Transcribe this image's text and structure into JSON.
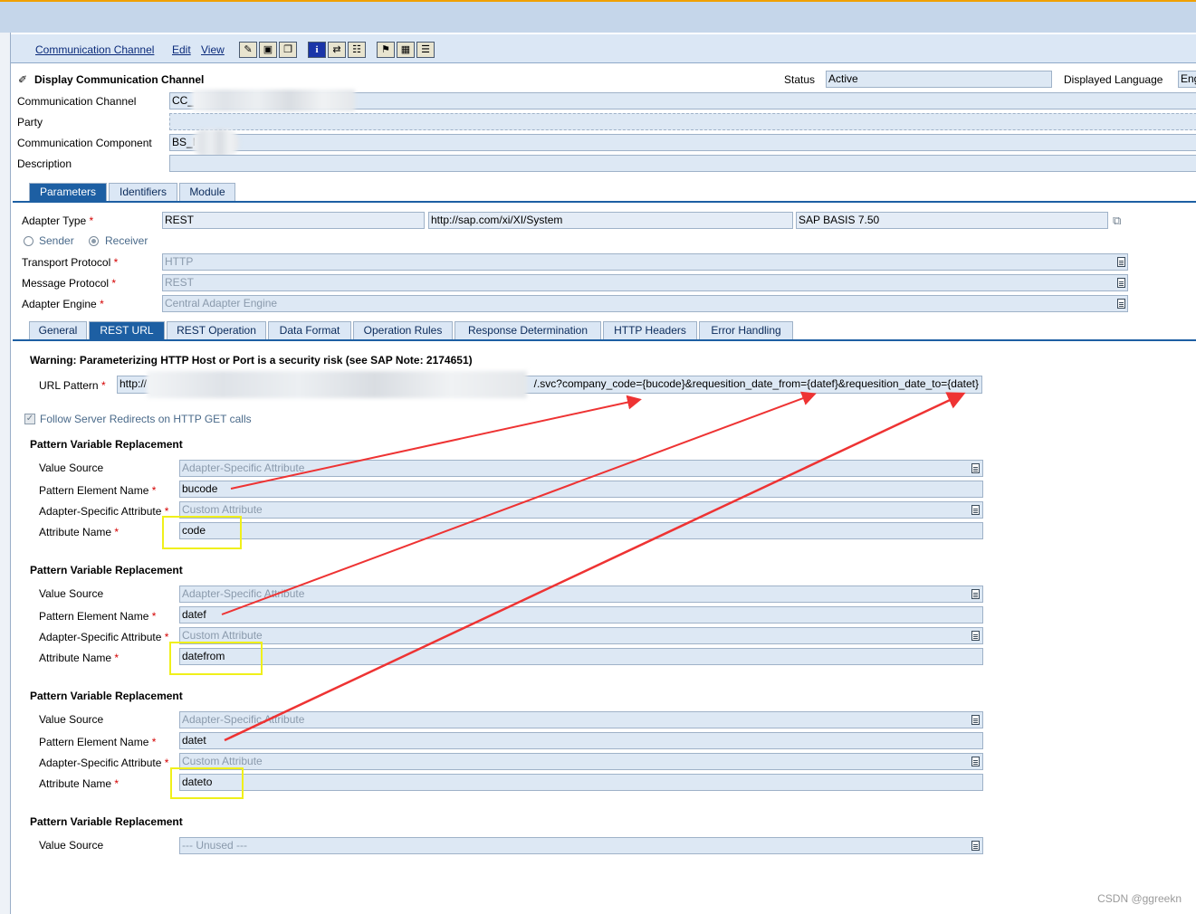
{
  "menu": {
    "items": [
      {
        "label": "Communication Channel"
      },
      {
        "label": "Edit"
      },
      {
        "label": "View"
      }
    ]
  },
  "header": {
    "title": "Display Communication Channel",
    "status_label": "Status",
    "status_value": "Active",
    "lang_label": "Displayed Language",
    "lang_value": "Eng"
  },
  "object": {
    "channel_label": "Communication Channel",
    "channel_value": "CC_",
    "party_label": "Party",
    "party_value": "",
    "component_label": "Communication Component",
    "component_value": "BS_I",
    "description_label": "Description",
    "description_value": ""
  },
  "main_tabs": [
    "Parameters",
    "Identifiers",
    "Module"
  ],
  "adapter": {
    "type_label": "Adapter Type",
    "type_value": "REST",
    "namespace": "http://sap.com/xi/XI/System",
    "version": "SAP BASIS 7.50",
    "sender_label": "Sender",
    "receiver_label": "Receiver",
    "transport_label": "Transport Protocol",
    "transport_value": "HTTP",
    "message_label": "Message Protocol",
    "message_value": "REST",
    "engine_label": "Adapter Engine",
    "engine_value": "Central Adapter Engine"
  },
  "sub_tabs": [
    "General",
    "REST URL",
    "REST Operation",
    "Data Format",
    "Operation Rules",
    "Response Determination",
    "HTTP Headers",
    "Error Handling"
  ],
  "rest_url": {
    "warning": "Warning: Parameterizing HTTP Host or Port is a security risk (see SAP Note: 2174651)",
    "url_label": "URL Pattern",
    "url_prefix": "http://",
    "url_suffix": "/.svc?company_code={bucode}&requesition_date_from={datef}&requesition_date_to={datet}",
    "follow_label": "Follow Server Redirects on HTTP GET calls"
  },
  "replacement_labels": {
    "section": "Pattern Variable Replacement",
    "value_source": "Value Source",
    "element_name": "Pattern Element Name",
    "specific_attr": "Adapter-Specific Attribute",
    "attr_name": "Attribute Name"
  },
  "replacements": [
    {
      "value_source": "Adapter-Specific Attribute",
      "element_name": "bucode",
      "specific_attr": "Custom Attribute",
      "attr_name": "code"
    },
    {
      "value_source": "Adapter-Specific Attribute",
      "element_name": "datef",
      "specific_attr": "Custom Attribute",
      "attr_name": "datefrom"
    },
    {
      "value_source": "Adapter-Specific Attribute",
      "element_name": "datet",
      "specific_attr": "Custom Attribute",
      "attr_name": "dateto"
    },
    {
      "value_source": "--- Unused ---"
    }
  ],
  "watermark": "CSDN @ggreekn",
  "colors": {
    "accent": "#1d5fa3",
    "highlight": "#f0f01a",
    "arrow": "#ee3333",
    "field": "#dde8f4"
  }
}
